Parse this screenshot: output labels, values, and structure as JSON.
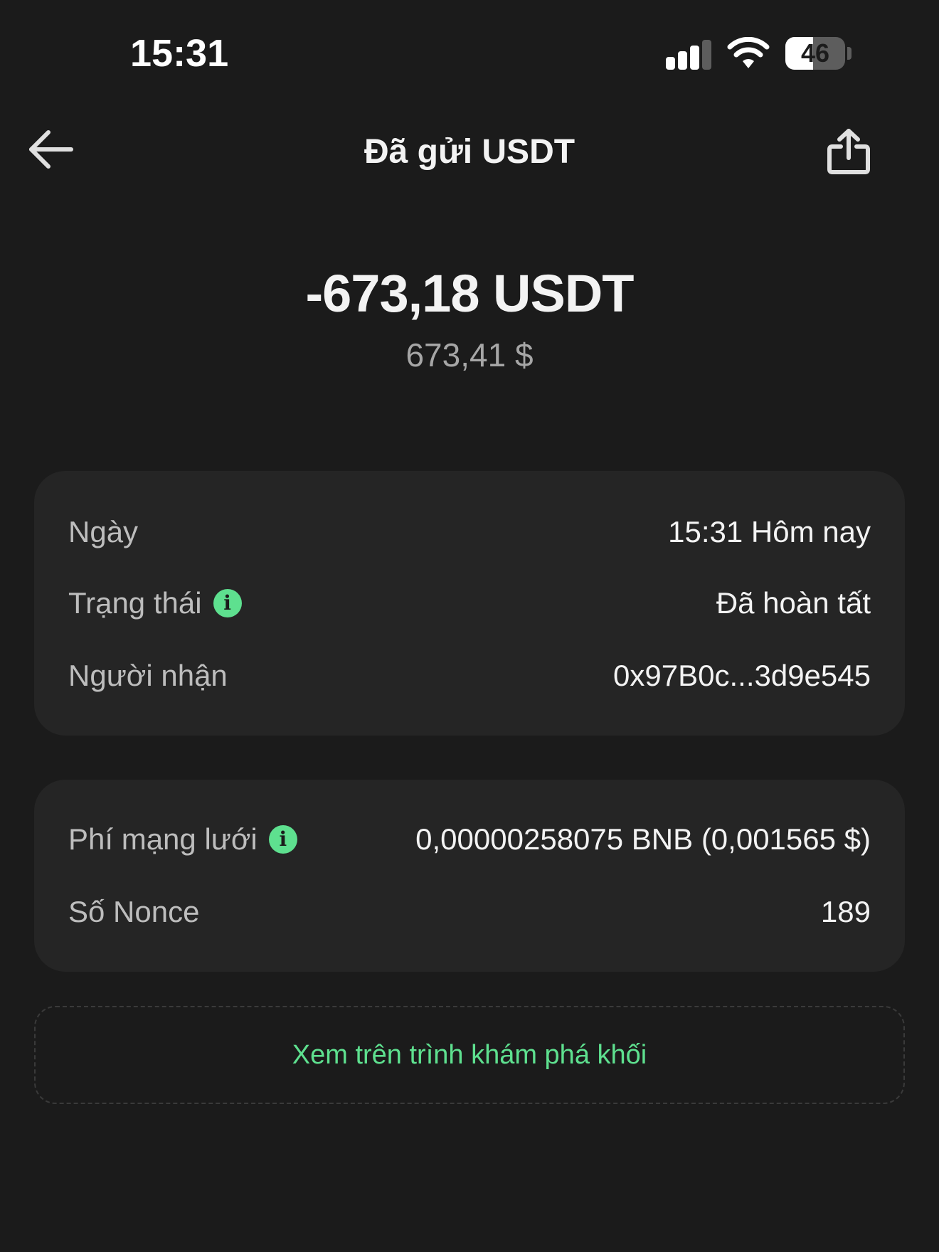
{
  "status_bar": {
    "time": "15:31",
    "battery_level": "46",
    "battery_percent": 46,
    "icons": [
      "signal-icon",
      "wifi-icon",
      "battery-icon"
    ]
  },
  "header": {
    "title": "Đã gửi USDT",
    "back_icon": "arrow-left-icon",
    "share_icon": "share-icon"
  },
  "amount": {
    "crypto": "-673,18 USDT",
    "fiat": "673,41 $"
  },
  "details": [
    {
      "label": "Ngày",
      "value": "15:31 Hôm nay"
    },
    {
      "label": "Trạng thái",
      "value": "Đã hoàn tất"
    },
    {
      "label": "Người nhận",
      "value": "0x97B0c...3d9e545"
    }
  ],
  "fees": [
    {
      "label": "Phí mạng lưới",
      "value": "0,00000258075 BNB (0,001565 $)"
    },
    {
      "label": "Số Nonce",
      "value": "189"
    }
  ],
  "explorer_link": "Xem trên trình khám phá khối",
  "colors": {
    "background": "#1b1b1b",
    "card": "#252525",
    "accent": "#5ee08f",
    "text_primary": "#f3f3f3",
    "text_secondary": "#bdbdbd"
  }
}
